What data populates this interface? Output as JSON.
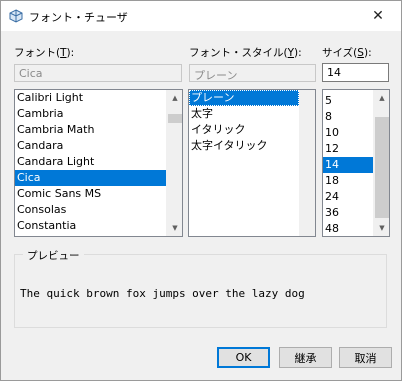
{
  "window": {
    "title": "フォント・チューザ",
    "close_glyph": "✕"
  },
  "font": {
    "label_prefix": "フォント(",
    "label_key": "T",
    "label_suffix": "):",
    "current": "Cica",
    "items": [
      "Calibri Light",
      "Cambria",
      "Cambria Math",
      "Candara",
      "Candara Light",
      "Cica",
      "Comic Sans MS",
      "Consolas",
      "Constantia"
    ],
    "selected": "Cica"
  },
  "style": {
    "label_prefix": "フォント・スタイル(",
    "label_key": "Y",
    "label_suffix": "):",
    "current": "プレーン",
    "items": [
      "プレーン",
      "太字",
      "イタリック",
      "太字イタリック"
    ],
    "selected": "プレーン"
  },
  "size": {
    "label_prefix": "サイズ(",
    "label_key": "S",
    "label_suffix": "):",
    "current": "14",
    "items": [
      "5",
      "8",
      "10",
      "12",
      "14",
      "18",
      "24",
      "36",
      "48"
    ],
    "selected": "14"
  },
  "preview": {
    "label": "プレビュー",
    "text": "The quick brown fox jumps over the lazy dog"
  },
  "buttons": {
    "ok": "OK",
    "inherit": "継承",
    "cancel": "取消"
  },
  "colors": {
    "selection": "#0078d7",
    "accent": "#0078d7"
  }
}
